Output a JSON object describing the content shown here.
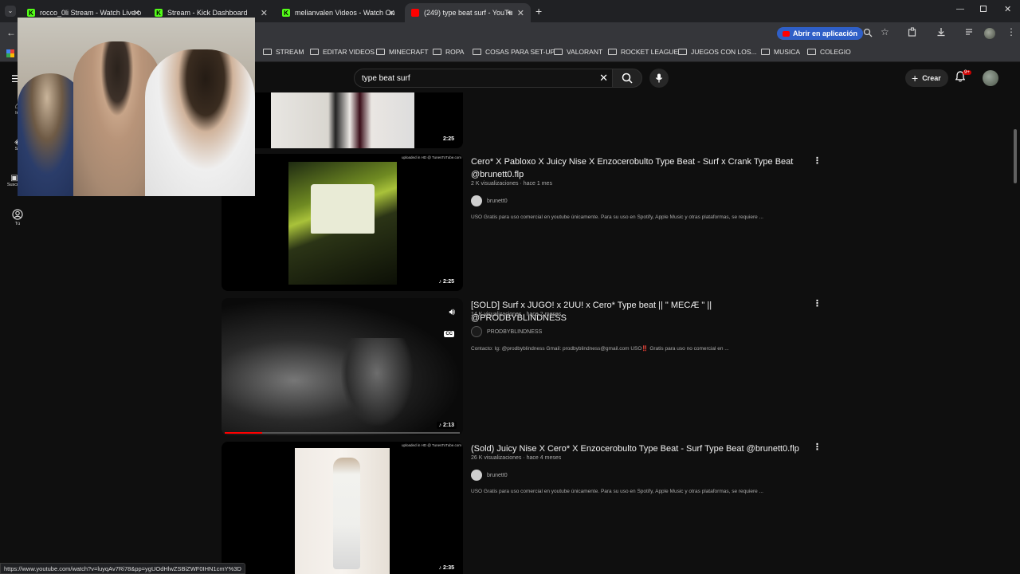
{
  "tabs": [
    {
      "label": "rocco_0li Stream - Watch Live o",
      "type": "kick"
    },
    {
      "label": "Stream - Kick Dashboard",
      "type": "kick"
    },
    {
      "label": "melianvalen Videos - Watch On",
      "type": "kick"
    },
    {
      "label": "(249) type beat surf - YouTu",
      "type": "youtube"
    }
  ],
  "toolbar": {
    "open_in_app": "Abrir en aplicación"
  },
  "bookmarks": [
    "STREAM",
    "EDITAR VIDEOS",
    "MINECRAFT",
    "ROPA",
    "COSAS PARA SET-UP",
    "VALORANT",
    "ROCKET LEAGUE",
    "JUEGOS CON LOS...",
    "MUSICA",
    "COLEGIO"
  ],
  "search": {
    "query": "type beat surf"
  },
  "header": {
    "create_label": "Crear",
    "notifications_badge": "9+"
  },
  "sidebar": {
    "items": [
      {
        "label": "Ini"
      },
      {
        "label": "Sh"
      },
      {
        "label": "Suscrip"
      },
      {
        "label": "Tú"
      }
    ]
  },
  "results": [
    {
      "duration": "2:25"
    },
    {
      "title": "Cero* X Pabloxo X Juicy Nise X Enzocerobulto Type Beat - Surf x Crank Type Beat @brunett0.flp",
      "meta": "2 K visualizaciones · hace 1 mes",
      "channel": "brunett0",
      "description": "USO Gratis para uso comercial en youtube únicamente. Para su uso en Spotify, Apple Music y otras plataformas, se requiere ...",
      "duration": "2:25",
      "watermark": "uploaded in HD @ TunesToTube.com"
    },
    {
      "title": "[SOLD] Surf x JUGO! x 2UU! x Cero* Type beat || \" MECÆ \" || @PRODBYBLINDNESS",
      "meta": "14 K visualizaciones · hace 2 meses",
      "channel": "PRODBYBLINDNESS",
      "description": "Contacto: Ig: @prodbyblindness Gmail: prodbyblindness@gmail.com USO‼️ Gratis para uso no comercial en ...",
      "duration": "2:13",
      "cc": "CC",
      "progress": 0.16
    },
    {
      "title": "(Sold) Juicy Nise X Cero* X Enzocerobulto Type Beat - Surf Type Beat @brunett0.flp",
      "meta": "26 K visualizaciones · hace 4 meses",
      "channel": "brunett0",
      "description": "USO Gratis para uso comercial en youtube únicamente. Para su uso en Spotify, Apple Music y otras plataformas, se requiere ...",
      "duration": "2:35",
      "watermark": "uploaded in HD @ TunesToTube.com"
    }
  ],
  "status_bar": {
    "url": "https://www.youtube.com/watch?v=luyqAv7Ri78&pp=ygUOdHlwZSBiZWF0IHN1cmY%3D"
  }
}
